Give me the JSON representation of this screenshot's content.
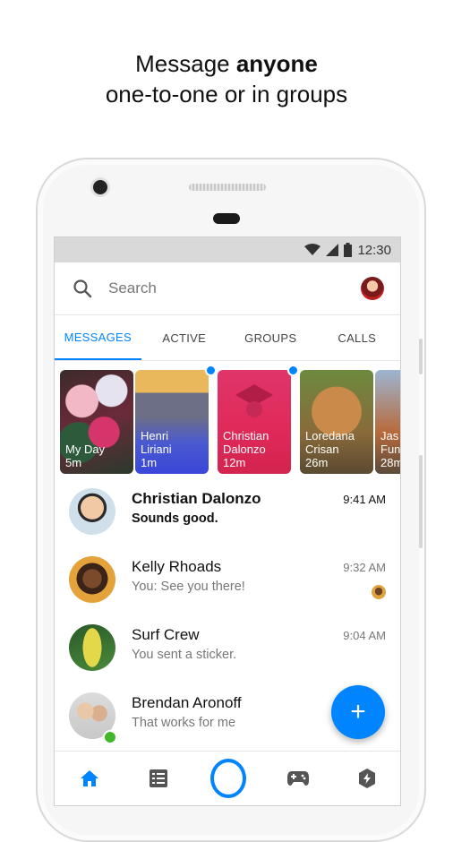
{
  "promo": {
    "line1_prefix": "Message ",
    "line1_bold": "anyone",
    "line2": "one-to-one or in groups"
  },
  "status_bar": {
    "time": "12:30",
    "icons": [
      "wifi-icon",
      "signal-icon",
      "battery-icon"
    ]
  },
  "search": {
    "placeholder": "Search"
  },
  "tabs": [
    {
      "label": "MESSAGES",
      "active": true
    },
    {
      "label": "ACTIVE",
      "active": false
    },
    {
      "label": "GROUPS",
      "active": false
    },
    {
      "label": "CALLS",
      "active": false
    }
  ],
  "stories": [
    {
      "name_line1": "My Day",
      "name_line2": "",
      "time": "5m",
      "unseen": false
    },
    {
      "name_line1": "Henri",
      "name_line2": "Liriani",
      "time": "1m",
      "unseen": true
    },
    {
      "name_line1": "Christian",
      "name_line2": "Dalonzo",
      "time": "12m",
      "unseen": true
    },
    {
      "name_line1": "Loredana",
      "name_line2": "Crisan",
      "time": "26m",
      "unseen": false
    },
    {
      "name_line1": "Jas",
      "name_line2": "Fun",
      "time": "28m",
      "unseen": false
    }
  ],
  "conversations": [
    {
      "name": "Christian Dalonzo",
      "message": "Sounds good.",
      "time": "9:41 AM",
      "unread": true,
      "online": false
    },
    {
      "name": "Kelly Rhoads",
      "message": "You: See you there!",
      "time": "9:32 AM",
      "unread": false,
      "online": false
    },
    {
      "name": "Surf Crew",
      "message": "You sent a sticker.",
      "time": "9:04 AM",
      "unread": false,
      "online": false
    },
    {
      "name": "Brendan Aronoff",
      "message": "That works for me",
      "time": "",
      "unread": false,
      "online": true
    }
  ],
  "fab": {
    "symbol": "+"
  },
  "bottom_nav": [
    "home-icon",
    "list-icon",
    "camera-icon",
    "games-icon",
    "discover-icon"
  ],
  "colors": {
    "accent": "#0084ff",
    "online": "#42b72a"
  }
}
